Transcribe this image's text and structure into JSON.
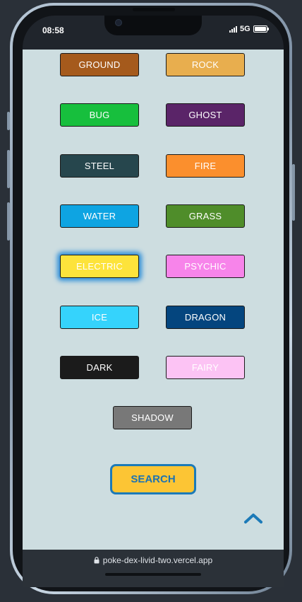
{
  "status": {
    "time": "08:58",
    "network": "5G"
  },
  "browser": {
    "url": "poke-dex-livid-two.vercel.app"
  },
  "types": [
    {
      "label": "GROUND",
      "color": "#a55a1c",
      "selected": false,
      "text_color": "#ffffff"
    },
    {
      "label": "ROCK",
      "color": "#e8ae4e",
      "selected": false,
      "text_color": "#ffffff"
    },
    {
      "label": "BUG",
      "color": "#17bf3d",
      "selected": false,
      "text_color": "#ffffff"
    },
    {
      "label": "GHOST",
      "color": "#5a2468",
      "selected": false,
      "text_color": "#ffffff"
    },
    {
      "label": "STEEL",
      "color": "#26464d",
      "selected": false,
      "text_color": "#ffffff"
    },
    {
      "label": "FIRE",
      "color": "#fb8f2d",
      "selected": false,
      "text_color": "#ffffff"
    },
    {
      "label": "WATER",
      "color": "#0ea4e2",
      "selected": false,
      "text_color": "#ffffff"
    },
    {
      "label": "GRASS",
      "color": "#4f8d2a",
      "selected": false,
      "text_color": "#ffffff"
    },
    {
      "label": "ELECTRIC",
      "color": "#fde33b",
      "selected": true,
      "text_color": "#ffffff"
    },
    {
      "label": "PSYCHIC",
      "color": "#f784ea",
      "selected": false,
      "text_color": "#ffffff"
    },
    {
      "label": "ICE",
      "color": "#35d3fc",
      "selected": false,
      "text_color": "#ffffff"
    },
    {
      "label": "DRAGON",
      "color": "#04457e",
      "selected": false,
      "text_color": "#ffffff"
    },
    {
      "label": "DARK",
      "color": "#1b1b1b",
      "selected": false,
      "text_color": "#ffffff"
    },
    {
      "label": "FAIRY",
      "color": "#fcc3f4",
      "selected": false,
      "text_color": "#ffffff"
    },
    {
      "label": "SHADOW",
      "color": "#787878",
      "selected": false,
      "text_color": "#ffffff"
    }
  ],
  "search_button": {
    "label": "SEARCH"
  },
  "icons": {
    "scroll_top": "chevron-up-icon",
    "lock": "lock-icon"
  },
  "colors": {
    "page_bg": "#cddde0",
    "accent": "#1c7ab8",
    "search_bg": "#fcc534"
  }
}
